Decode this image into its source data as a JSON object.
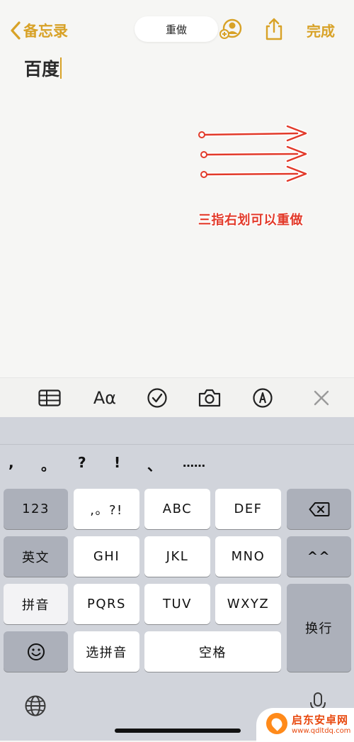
{
  "nav": {
    "back_label": "备忘录",
    "hud_label": "重做",
    "done_label": "完成",
    "accent": "#d8a227"
  },
  "note": {
    "title": "百度"
  },
  "annotation": {
    "text": "三指右划可以重做",
    "color": "#e23a2a"
  },
  "toolbar": {
    "icons": [
      "table-icon",
      "format-text-icon",
      "checklist-icon",
      "camera-icon",
      "markup-pen-icon",
      "close-icon"
    ],
    "format_label": "Aα"
  },
  "keyboard": {
    "punctuation": [
      ",",
      "。",
      "?",
      "!",
      "、",
      "……"
    ],
    "row1": [
      "123",
      ",。?!",
      "ABC",
      "DEF"
    ],
    "row2": [
      "英文",
      "GHI",
      "JKL",
      "MNO",
      "^^"
    ],
    "row3": [
      "拼音",
      "PQRS",
      "TUV",
      "WXYZ"
    ],
    "row4": [
      "选拼音",
      "空格"
    ],
    "return_label": "换行"
  },
  "watermark": {
    "title": "启东安卓网",
    "url": "www.qdltdq.com"
  }
}
